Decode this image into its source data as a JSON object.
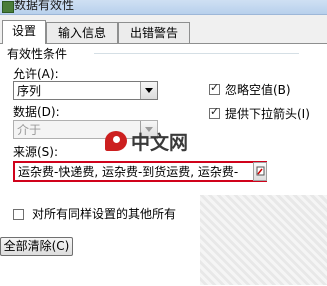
{
  "window": {
    "title": "数据有效性"
  },
  "tabs": [
    {
      "label": "设置",
      "active": true
    },
    {
      "label": "输入信息",
      "active": false
    },
    {
      "label": "出错警告",
      "active": false
    }
  ],
  "criteria": {
    "group_label": "有效性条件",
    "allow_label": "允许(A):",
    "allow_value": "序列",
    "data_label": "数据(D):",
    "data_value": "介于",
    "ignore_blank": {
      "label": "忽略空值(B)",
      "checked": true
    },
    "dropdown_arrow": {
      "label": "提供下拉箭头(I)",
      "checked": true
    },
    "source_label": "来源(S):",
    "source_value": "运杂费-快递费, 运杂费-到货运费, 运杂费-"
  },
  "apply_all": {
    "label": "对所有同样设置的其他所有",
    "checked": false
  },
  "buttons": {
    "clear_all": "全部清除(C)"
  },
  "watermark": {
    "text": "中文网"
  },
  "colors": {
    "highlight": "#d0021b",
    "panel": "#ffffff",
    "chrome": "#f0f0f0"
  }
}
